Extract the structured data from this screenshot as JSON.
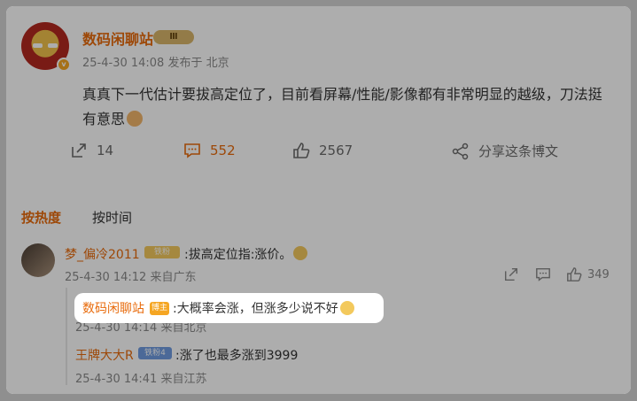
{
  "post": {
    "author": "数码闲聊站",
    "level_badge": "Ⅲ",
    "verified_mark": "v",
    "meta": "25-4-30 14:08  发布于 北京",
    "text": "真真下一代估计要拔高定位了，目前看屏幕/性能/影像都有非常明显的越级，刀法挺有意思",
    "emoji_icon": "cat-face-icon"
  },
  "actions": {
    "repost_count": "14",
    "comment_count": "552",
    "like_count": "2567",
    "share_label": "分享这条博文"
  },
  "sort": {
    "hot_label": "按热度",
    "time_label": "按时间"
  },
  "comment": {
    "user": "梦_偏冷2011",
    "fan_badge": "铁粉",
    "text": ":拔高定位指:涨价。",
    "meta": "25-4-30 14:12 来自广东",
    "like_count": "349"
  },
  "replies": [
    {
      "user": "数码闲聊站",
      "badge": "博主",
      "text": ":大概率会涨，但涨多少说不好",
      "meta": "25-4-30 14:14 来自北京"
    },
    {
      "user": "王牌大大R",
      "badge": "铁粉4",
      "text": ":涨了也最多涨到3999",
      "meta": "25-4-30 14:41 来自江苏"
    }
  ],
  "colors": {
    "accent": "#e86b0c",
    "overlay": "#8f8f8f",
    "text": "#333333",
    "muted": "#8a8a8a"
  }
}
